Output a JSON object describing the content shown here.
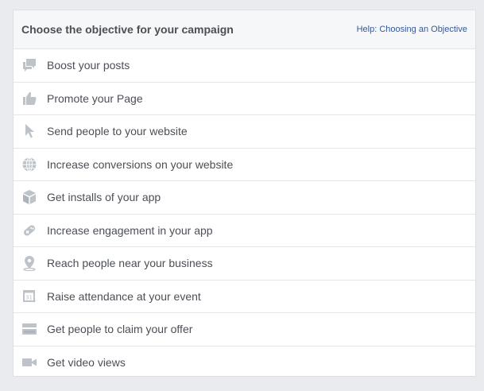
{
  "header": {
    "title": "Choose the objective for your campaign",
    "help_link": "Help: Choosing an Objective"
  },
  "colors": {
    "background": "#e9ebee",
    "panel": "#ffffff",
    "header_bg": "#f6f7f9",
    "icon": "#bec3c9",
    "text": "#4b4f56",
    "link": "#365899"
  },
  "objectives": [
    {
      "label": "Boost your posts",
      "icon": "speech-bubbles-icon"
    },
    {
      "label": "Promote your Page",
      "icon": "thumbs-up-icon"
    },
    {
      "label": "Send people to your website",
      "icon": "cursor-arrow-icon"
    },
    {
      "label": "Increase conversions on your website",
      "icon": "globe-icon"
    },
    {
      "label": "Get installs of your app",
      "icon": "cube-icon"
    },
    {
      "label": "Increase engagement in your app",
      "icon": "gamepad-icon"
    },
    {
      "label": "Reach people near your business",
      "icon": "location-pin-icon"
    },
    {
      "label": "Raise attendance at your event",
      "icon": "calendar-icon"
    },
    {
      "label": "Get people to claim your offer",
      "icon": "offer-ticket-icon"
    },
    {
      "label": "Get video views",
      "icon": "video-camera-icon"
    }
  ]
}
